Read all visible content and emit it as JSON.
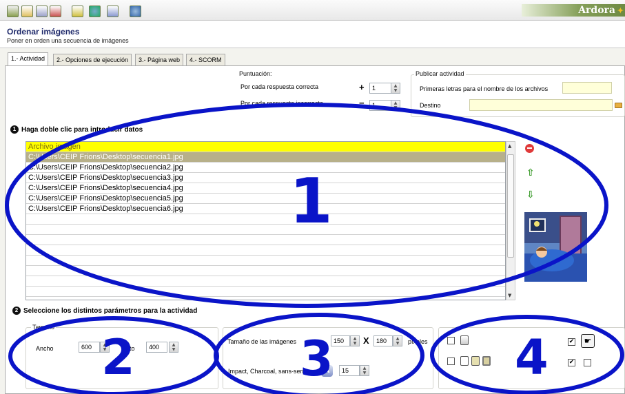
{
  "brand": {
    "name": "Ardora"
  },
  "toolbar": {
    "icons": [
      "new-icon",
      "open-icon",
      "save-icon",
      "save-as-icon",
      "book-icon",
      "globe-icon",
      "preview-icon",
      "help-icon"
    ]
  },
  "header": {
    "title": "Ordenar imágenes",
    "subtitle": "Poner en orden una secuencia de imágenes"
  },
  "tabs": [
    {
      "label": "1.- Actividad",
      "active": true
    },
    {
      "label": "2.- Opciones de ejecución",
      "active": false
    },
    {
      "label": "3.- Página web",
      "active": false
    },
    {
      "label": "4.- SCORM",
      "active": false
    }
  ],
  "puntuacion": {
    "label": "Puntuación:",
    "correct_label": "Por cada respuesta correcta",
    "correct_sign": "+",
    "correct_value": "1",
    "incorrect_label": "Por cada respuesta incorrecta",
    "incorrect_sign": "−",
    "incorrect_value": "1"
  },
  "publicar": {
    "label": "Publicar actividad",
    "file_prefix_label": "Primeras letras para el nombre de los archivos",
    "file_prefix_value": "",
    "destino_label": "Destino",
    "destino_value": ""
  },
  "section1": {
    "number": "1",
    "title": "Haga doble clic para introducir datos"
  },
  "table": {
    "header": "Archivo imagen",
    "rows": [
      "C:\\Users\\CEIP Frions\\Desktop\\secuencia1.jpg",
      "C:\\Users\\CEIP Frions\\Desktop\\secuencia2.jpg",
      "C:\\Users\\CEIP Frions\\Desktop\\secuencia3.jpg",
      "C:\\Users\\CEIP Frions\\Desktop\\secuencia4.jpg",
      "C:\\Users\\CEIP Frions\\Desktop\\secuencia5.jpg",
      "C:\\Users\\CEIP Frions\\Desktop\\secuencia6.jpg"
    ],
    "selected_index": 0
  },
  "section2": {
    "number": "2",
    "title": "Seleccione los distintos parámetros para la actividad"
  },
  "tamano": {
    "label": "Tamaño",
    "ancho_label": "Ancho",
    "ancho_value": "600",
    "alto_label": "Alto",
    "alto_value": "400"
  },
  "imagenes": {
    "size_label": "Tamaño de las imágenes",
    "width_value": "150",
    "x_label": "X",
    "height_value": "180",
    "unit_label": "píxeles",
    "font_value": "Impact, Charcoal, sans-serif",
    "font_size_value": "15"
  },
  "annotations": [
    "1",
    "2",
    "3",
    "4"
  ],
  "colors": {
    "accent": "#0a14c8",
    "header_row": "#ffff00",
    "selected_row": "#b7b08a",
    "brand": "#86a05a"
  }
}
